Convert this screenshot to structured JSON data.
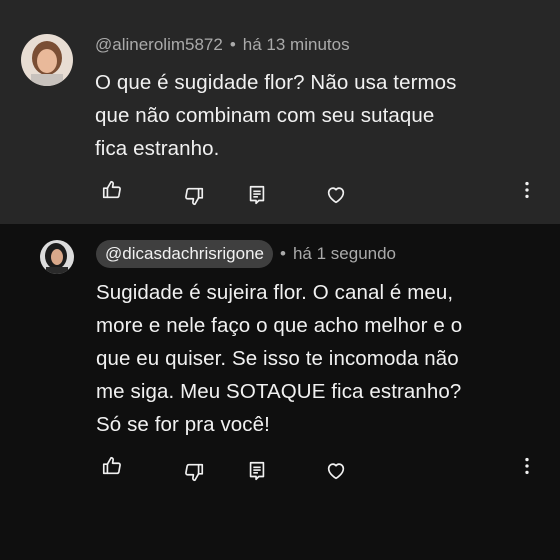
{
  "comments": [
    {
      "author": "@alinerolim5872",
      "time": "há 13 minutos",
      "separator": "•",
      "lines": [
        "O que é sugidade flor? Não usa termos",
        "que não combinam com seu sutaque",
        "fica estranho."
      ],
      "icons": [
        "like-icon",
        "dislike-icon",
        "reply-icon",
        "heart-icon",
        "more-vert-icon"
      ]
    },
    {
      "author": "@dicasdachrisrigone",
      "time": "há 1 segundo",
      "separator": "•",
      "lines": [
        "Sugidade é sujeira flor. O canal é meu,",
        "more e nele faço o que acho melhor e o",
        "que eu quiser. Se isso te incomoda não",
        "me siga. Meu SOTAQUE fica estranho?",
        "Só se for pra você!"
      ],
      "icons": [
        "like-icon",
        "dislike-icon",
        "reply-icon",
        "heart-icon",
        "more-vert-icon"
      ]
    }
  ],
  "colors": {
    "highlight_bg": "#272727",
    "page_bg": "#0f0f0f",
    "text_primary": "#f1f1f1",
    "text_secondary": "#aaaaaa",
    "handle_pill": "#3f3f3f"
  }
}
